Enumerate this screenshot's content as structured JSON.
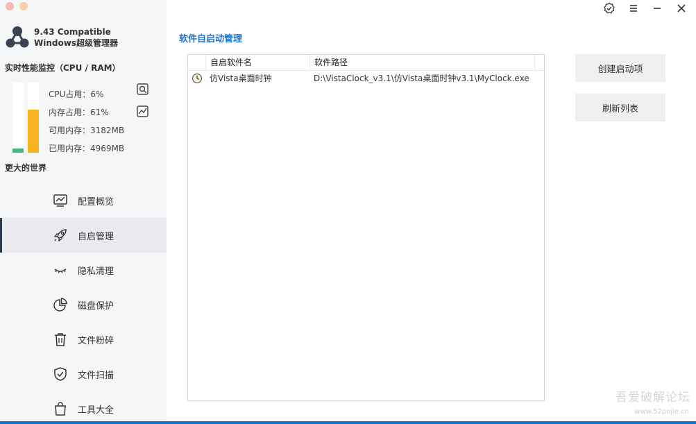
{
  "app": {
    "version_line": "9.43 Compatible",
    "name_line": "Windows超级管理器"
  },
  "perf": {
    "title": "实时性能监控（CPU / RAM）",
    "cpu_percent": 6,
    "mem_percent": 61,
    "cpu_label": "CPU占用：6%",
    "mem_label": "内存占用：61%",
    "avail_label": "可用内存：3182MB",
    "used_label": "已用内存：4969MB",
    "cpu_color": "#3dbb83",
    "mem_color": "#f8b21d"
  },
  "sidebar": {
    "world_label": "更大的世界",
    "items": [
      {
        "label": "配置概览",
        "icon": "monitor-chart-icon"
      },
      {
        "label": "自启管理",
        "icon": "rocket-icon",
        "active": true
      },
      {
        "label": "隐私清理",
        "icon": "closed-eye-icon"
      },
      {
        "label": "磁盘保护",
        "icon": "pie-chart-icon"
      },
      {
        "label": "文件粉碎",
        "icon": "trash-icon"
      },
      {
        "label": "文件扫描",
        "icon": "shield-check-icon"
      },
      {
        "label": "工具大全",
        "icon": "shopping-bag-icon"
      }
    ]
  },
  "main": {
    "title": "软件自启动管理",
    "table": {
      "headers": [
        "自启软件名",
        "软件路径"
      ],
      "rows": [
        {
          "name": "仿Vista桌面时钟",
          "path": "D:\\VistaClock_v3.1\\仿Vista桌面时钟v3.1\\MyClock.exe",
          "icon": "clock-icon"
        }
      ]
    },
    "buttons": {
      "create": "创建启动项",
      "refresh": "刷新列表"
    }
  },
  "window_controls": [
    "badge-check-icon",
    "menu-icon",
    "minimize-icon",
    "close-icon"
  ],
  "watermark": {
    "text": "吾爱破解论坛",
    "url": "www.52pojie.cn"
  },
  "colors": {
    "accent": "#1e6fc8",
    "sidebar_bg": "#f5f6f8",
    "active_item_bg": "#e9eaed"
  }
}
